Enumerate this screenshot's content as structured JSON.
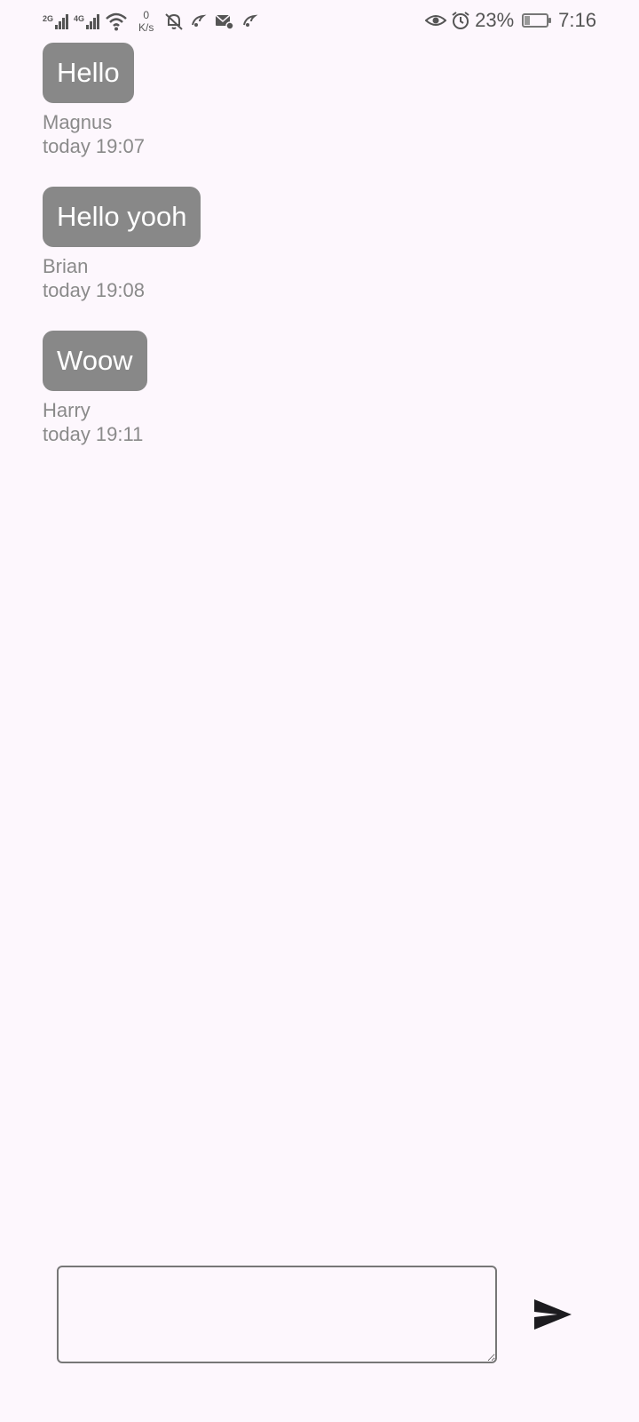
{
  "status_bar": {
    "network_1": "2G",
    "network_2": "4G",
    "speed_value": "0",
    "speed_unit": "K/s",
    "battery_percent": "23%",
    "battery_level": 0.23,
    "time": "7:16",
    "icons": [
      "signal-icon",
      "wifi-icon",
      "notifications-off-icon",
      "app-notification-icon",
      "mail-settings-icon",
      "eye-icon",
      "alarm-icon",
      "battery-charging-icon"
    ]
  },
  "messages": [
    {
      "text": "Hello",
      "sender": "Magnus",
      "time": "today 19:07"
    },
    {
      "text": "Hello yooh",
      "sender": "Brian",
      "time": "today 19:08"
    },
    {
      "text": "Woow",
      "sender": "Harry",
      "time": "today 19:11"
    }
  ],
  "composer": {
    "value": "",
    "placeholder": "",
    "send_icon": "send-icon"
  },
  "colors": {
    "background": "#fdf7fd",
    "bubble": "#888888",
    "bubble_text": "#ffffff",
    "meta_text": "#8a8a8a"
  }
}
